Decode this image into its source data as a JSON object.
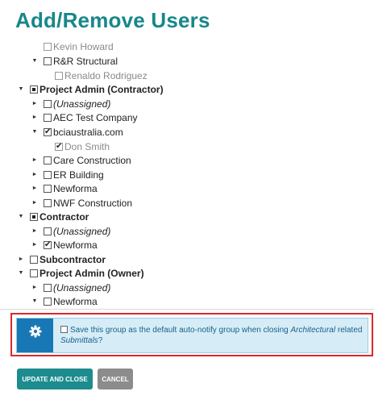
{
  "page": {
    "title": "Add/Remove Users"
  },
  "tree": [
    {
      "label": "Kevin Howard",
      "state": "unchecked",
      "style": "grey",
      "twisty": ""
    },
    {
      "label": "R&R Structural",
      "state": "unchecked",
      "style": "normal",
      "twisty": "▼"
    },
    {
      "label": "Renaldo Rodriguez",
      "state": "unchecked",
      "style": "grey",
      "twisty": ""
    },
    {
      "label": "Project Admin (Contractor)",
      "state": "partial",
      "style": "bold",
      "twisty": "▼"
    },
    {
      "label": "(Unassigned)",
      "state": "unchecked",
      "style": "italic",
      "twisty": "►"
    },
    {
      "label": "AEC Test Company",
      "state": "unchecked",
      "style": "normal",
      "twisty": "►"
    },
    {
      "label": "bciaustralia.com",
      "state": "checked",
      "style": "normal",
      "twisty": "▼"
    },
    {
      "label": "Don Smith",
      "state": "checked",
      "style": "grey",
      "twisty": ""
    },
    {
      "label": "Care Construction",
      "state": "unchecked",
      "style": "normal",
      "twisty": "►"
    },
    {
      "label": "ER Building",
      "state": "unchecked",
      "style": "normal",
      "twisty": "►"
    },
    {
      "label": "Newforma",
      "state": "unchecked",
      "style": "normal",
      "twisty": "►"
    },
    {
      "label": "NWF Construction",
      "state": "unchecked",
      "style": "normal",
      "twisty": "►"
    },
    {
      "label": "Contractor",
      "state": "partial",
      "style": "bold",
      "twisty": "▼"
    },
    {
      "label": "(Unassigned)",
      "state": "unchecked",
      "style": "italic",
      "twisty": "►"
    },
    {
      "label": "Newforma",
      "state": "checked",
      "style": "normal",
      "twisty": "►"
    },
    {
      "label": "Subcontractor",
      "state": "unchecked",
      "style": "bold",
      "twisty": "►"
    },
    {
      "label": "Project Admin (Owner)",
      "state": "unchecked",
      "style": "bold",
      "twisty": "▼"
    },
    {
      "label": "(Unassigned)",
      "state": "unchecked",
      "style": "italic",
      "twisty": "►"
    },
    {
      "label": "Newforma",
      "state": "unchecked",
      "style": "normal",
      "twisty": "▼"
    }
  ],
  "notice": {
    "icon": "gear-icon",
    "text_before": "Save this group as the default auto-notify group when closing ",
    "text_em1": "Architectural",
    "text_mid": " related ",
    "text_em2": "Submittals",
    "text_after": "?"
  },
  "buttons": {
    "update": "UPDATE AND CLOSE",
    "cancel": "CANCEL"
  },
  "colors": {
    "title": "#18878a",
    "primary_button": "#1c8c8f",
    "cancel_button": "#8c8c8c",
    "notice_bg": "#d6edf7",
    "notice_icon_bg": "#1778b5",
    "highlight_border": "#d9292c"
  }
}
